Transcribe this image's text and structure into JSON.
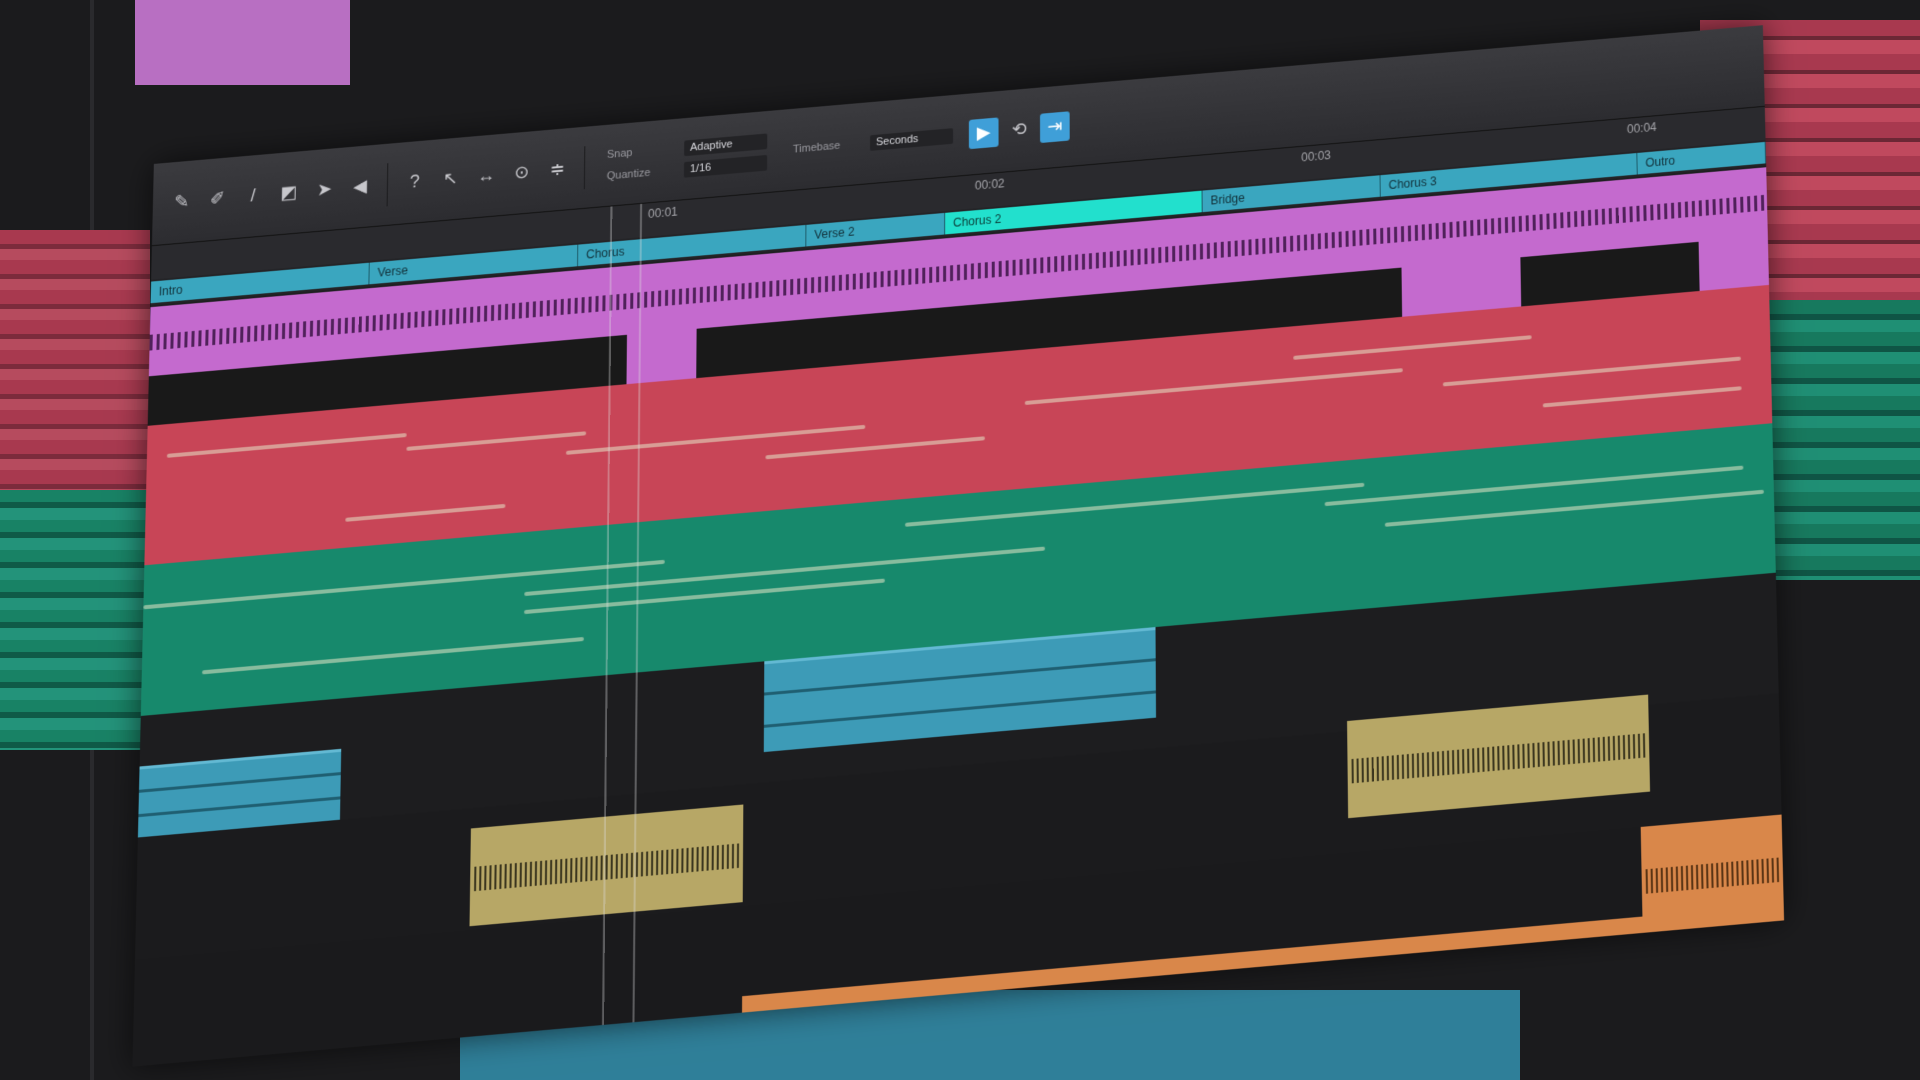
{
  "colors": {
    "vocal": "#c46ace",
    "keys": "#c84557",
    "pad": "#17896c",
    "bass": "#3d9bb7",
    "drums": "#b7a766",
    "fx": "#d9874a",
    "section": "#3aa6bf",
    "section_active": "#22e0cd",
    "tool_active": "#3f9fd8"
  },
  "toolbar": {
    "tools": [
      {
        "name": "pencil-icon",
        "glyph": "✎"
      },
      {
        "name": "brush-icon",
        "glyph": "✐"
      },
      {
        "name": "line-icon",
        "glyph": "/"
      },
      {
        "name": "eraser-icon",
        "glyph": "◩"
      },
      {
        "name": "pointer-icon",
        "glyph": "➤"
      },
      {
        "name": "speaker-icon",
        "glyph": "◀"
      },
      {
        "name": "help-icon",
        "glyph": "?"
      },
      {
        "name": "arrow-icon",
        "glyph": "↖"
      },
      {
        "name": "range-icon",
        "glyph": "↔"
      },
      {
        "name": "zoom-icon",
        "glyph": "⊙"
      },
      {
        "name": "split-icon",
        "glyph": "≑"
      }
    ],
    "snap_label": "Snap",
    "quantize_label": "Quantize",
    "timebase_label": "Timebase",
    "snap_value": "Adaptive",
    "quantize_value": "1/16",
    "timebase_value": "Seconds"
  },
  "ruler": {
    "marks": [
      "00:01",
      "00:02",
      "00:03",
      "00:04"
    ]
  },
  "sections": [
    {
      "label": "Intro"
    },
    {
      "label": "Verse"
    },
    {
      "label": "Chorus"
    },
    {
      "label": "Verse 2"
    },
    {
      "label": "Chorus 2"
    },
    {
      "label": "Bridge"
    },
    {
      "label": "Chorus 3"
    },
    {
      "label": "Outro"
    }
  ]
}
